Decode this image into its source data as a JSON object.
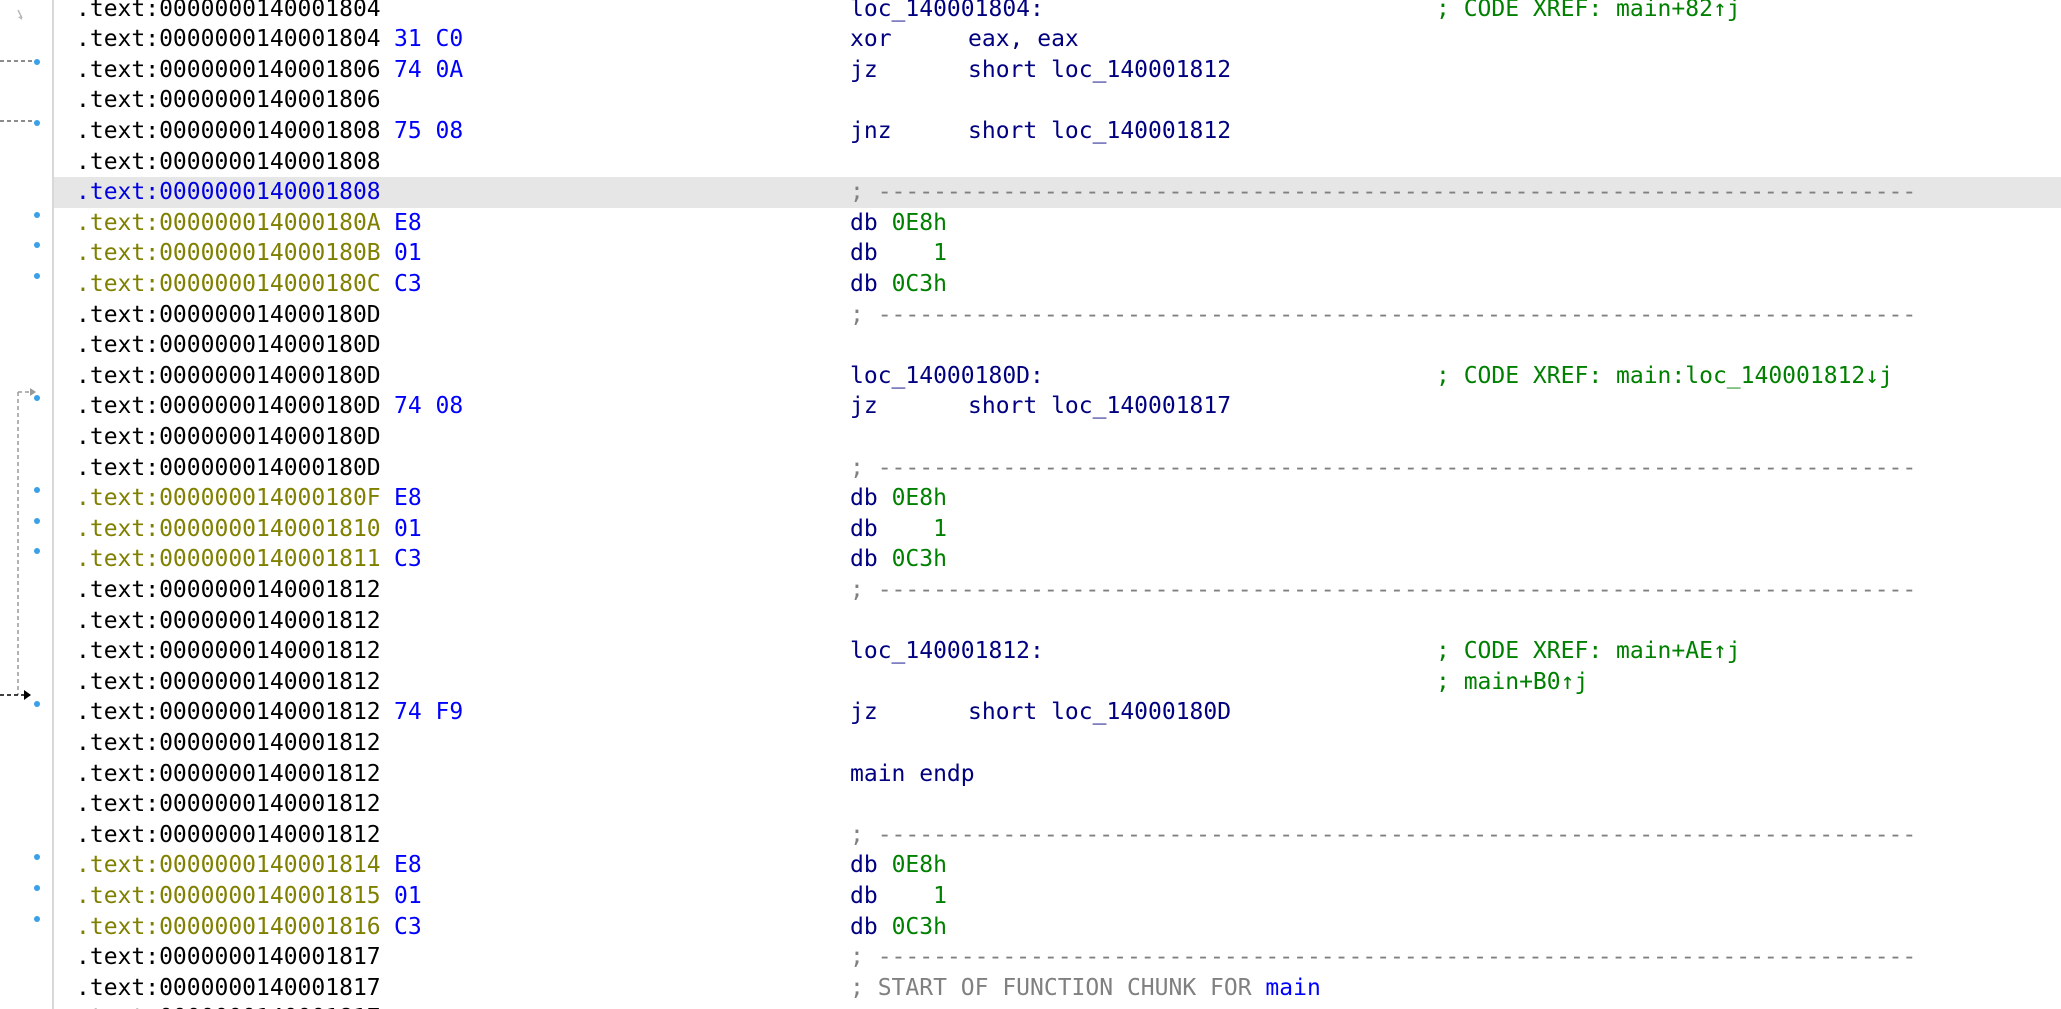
{
  "colors": {
    "address": "#000000",
    "address_data": "#808000",
    "address_highlight": "#0000e0",
    "bytes": "#0000ff",
    "mnemonic": "#000080",
    "number": "#008000",
    "comment": "#808080",
    "xref": "#008000",
    "highlight_bg": "#e6e6e6",
    "gutter_dot": "#3aa0e8"
  },
  "listing": {
    "rows": [
      {
        "addr": ".text:0000000140001804",
        "kind": "label",
        "label": "loc_140001804:",
        "xref": "; CODE XREF: main+82↑j"
      },
      {
        "addr": ".text:0000000140001804",
        "bytes": "31 C0",
        "kind": "instr",
        "mnem": "xor",
        "opnd": "eax, eax"
      },
      {
        "addr": ".text:0000000140001806",
        "bytes": "74 0A",
        "kind": "instr",
        "mnem": "jz",
        "opnd": "short loc_140001812",
        "dot": true
      },
      {
        "addr": ".text:0000000140001806",
        "kind": "blank"
      },
      {
        "addr": ".text:0000000140001808",
        "bytes": "75 08",
        "kind": "instr",
        "mnem": "jnz",
        "opnd": "short loc_140001812",
        "dot": true
      },
      {
        "addr": ".text:0000000140001808",
        "kind": "blank"
      },
      {
        "addr": ".text:0000000140001808",
        "kind": "sep",
        "sep": "; ---------------------------------------------------------------------------",
        "highlight": true
      },
      {
        "addr": ".text:000000014000180A",
        "bytes": "E8",
        "kind": "db",
        "db": "db",
        "val": "0E8h",
        "data": true,
        "dot": true
      },
      {
        "addr": ".text:000000014000180B",
        "bytes": "01",
        "kind": "db",
        "db": "db",
        "val": "   1",
        "data": true,
        "dot": true
      },
      {
        "addr": ".text:000000014000180C",
        "bytes": "C3",
        "kind": "db",
        "db": "db",
        "val": "0C3h",
        "data": true,
        "dot": true
      },
      {
        "addr": ".text:000000014000180D",
        "kind": "sep",
        "sep": "; ---------------------------------------------------------------------------"
      },
      {
        "addr": ".text:000000014000180D",
        "kind": "blank"
      },
      {
        "addr": ".text:000000014000180D",
        "kind": "label",
        "label": "loc_14000180D:",
        "xref": "; CODE XREF: main:loc_140001812↓j"
      },
      {
        "addr": ".text:000000014000180D",
        "bytes": "74 08",
        "kind": "instr",
        "mnem": "jz",
        "opnd": "short loc_140001817",
        "dot": true
      },
      {
        "addr": ".text:000000014000180D",
        "kind": "blank"
      },
      {
        "addr": ".text:000000014000180D",
        "kind": "sep",
        "sep": "; ---------------------------------------------------------------------------"
      },
      {
        "addr": ".text:000000014000180F",
        "bytes": "E8",
        "kind": "db",
        "db": "db",
        "val": "0E8h",
        "data": true,
        "dot": true
      },
      {
        "addr": ".text:0000000140001810",
        "bytes": "01",
        "kind": "db",
        "db": "db",
        "val": "   1",
        "data": true,
        "dot": true
      },
      {
        "addr": ".text:0000000140001811",
        "bytes": "C3",
        "kind": "db",
        "db": "db",
        "val": "0C3h",
        "data": true,
        "dot": true
      },
      {
        "addr": ".text:0000000140001812",
        "kind": "sep",
        "sep": "; ---------------------------------------------------------------------------"
      },
      {
        "addr": ".text:0000000140001812",
        "kind": "blank"
      },
      {
        "addr": ".text:0000000140001812",
        "kind": "label",
        "label": "loc_140001812:",
        "xref": "; CODE XREF: main+AE↑j"
      },
      {
        "addr": ".text:0000000140001812",
        "kind": "xrefonly",
        "xref": "; main+B0↑j"
      },
      {
        "addr": ".text:0000000140001812",
        "bytes": "74 F9",
        "kind": "instr",
        "mnem": "jz",
        "opnd": "short loc_14000180D",
        "dot": true
      },
      {
        "addr": ".text:0000000140001812",
        "kind": "blank"
      },
      {
        "addr": ".text:0000000140001812",
        "kind": "label",
        "label": "main endp"
      },
      {
        "addr": ".text:0000000140001812",
        "kind": "blank"
      },
      {
        "addr": ".text:0000000140001812",
        "kind": "sep",
        "sep": "; ---------------------------------------------------------------------------"
      },
      {
        "addr": ".text:0000000140001814",
        "bytes": "E8",
        "kind": "db",
        "db": "db",
        "val": "0E8h",
        "data": true,
        "dot": true
      },
      {
        "addr": ".text:0000000140001815",
        "bytes": "01",
        "kind": "db",
        "db": "db",
        "val": "   1",
        "data": true,
        "dot": true
      },
      {
        "addr": ".text:0000000140001816",
        "bytes": "C3",
        "kind": "db",
        "db": "db",
        "val": "0C3h",
        "data": true,
        "dot": true
      },
      {
        "addr": ".text:0000000140001817",
        "kind": "sep",
        "sep": "; ---------------------------------------------------------------------------"
      },
      {
        "addr": ".text:0000000140001817",
        "kind": "chunk",
        "chunk": "; START OF FUNCTION CHUNK FOR ",
        "chunk_name": "main"
      },
      {
        "addr": ".text:0000000140001817",
        "kind": "blank"
      }
    ]
  }
}
